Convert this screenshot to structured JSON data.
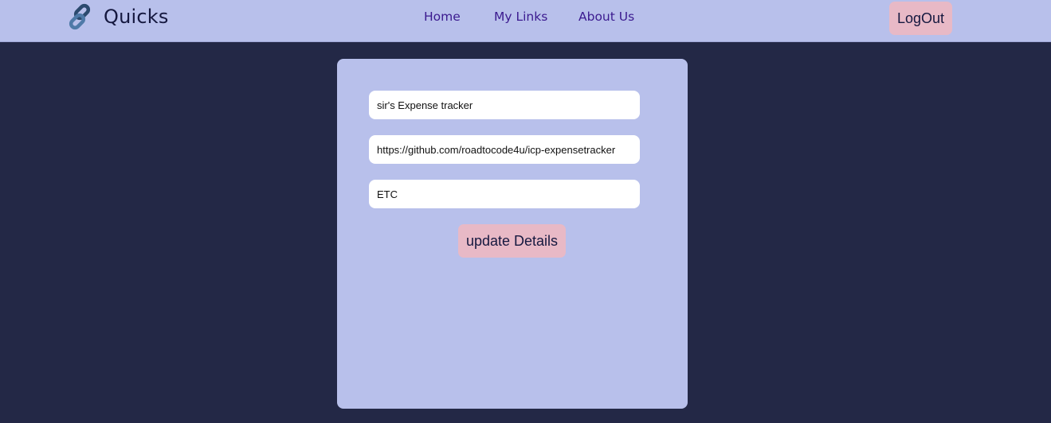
{
  "header": {
    "brand_name": "Quicks",
    "brand_icon": "link-icon",
    "nav": {
      "home": "Home",
      "my_links": "My Links",
      "about_us": "About Us"
    },
    "logout_label": "LogOut"
  },
  "form": {
    "title_value": "sir's Expense tracker",
    "url_value": "https://github.com/roadtocode4u/icp-expensetracker",
    "category_value": "ETC",
    "submit_label": "update Details"
  },
  "colors": {
    "page_background": "#232846",
    "navbar_background": "#b8c0eb",
    "card_background": "#b8c0eb",
    "button_background": "#e8b9c6",
    "nav_link": "#3b1a8f"
  }
}
